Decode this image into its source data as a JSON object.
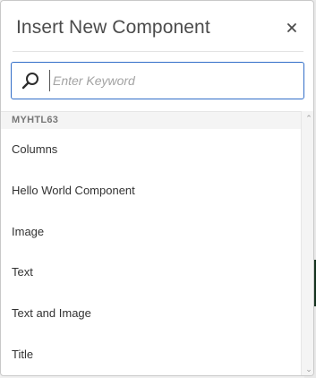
{
  "dialog": {
    "title": "Insert New Component",
    "close_label": "×"
  },
  "search": {
    "placeholder": "Enter Keyword",
    "value": ""
  },
  "list": {
    "group_label": "MYHTL63",
    "items": [
      {
        "label": "Columns"
      },
      {
        "label": "Hello World Component"
      },
      {
        "label": "Image"
      },
      {
        "label": "Text"
      },
      {
        "label": "Text and Image"
      },
      {
        "label": "Title"
      }
    ]
  },
  "scrollbar": {
    "up_icon": "chevron-up-icon",
    "down_icon": "chevron-down-icon",
    "up_glyph": "⌃",
    "down_glyph": "⌄"
  },
  "colors": {
    "accent": "#326ec8",
    "title_text": "#4b4b4b",
    "item_text": "#323232",
    "group_header_bg": "#f4f4f4"
  }
}
